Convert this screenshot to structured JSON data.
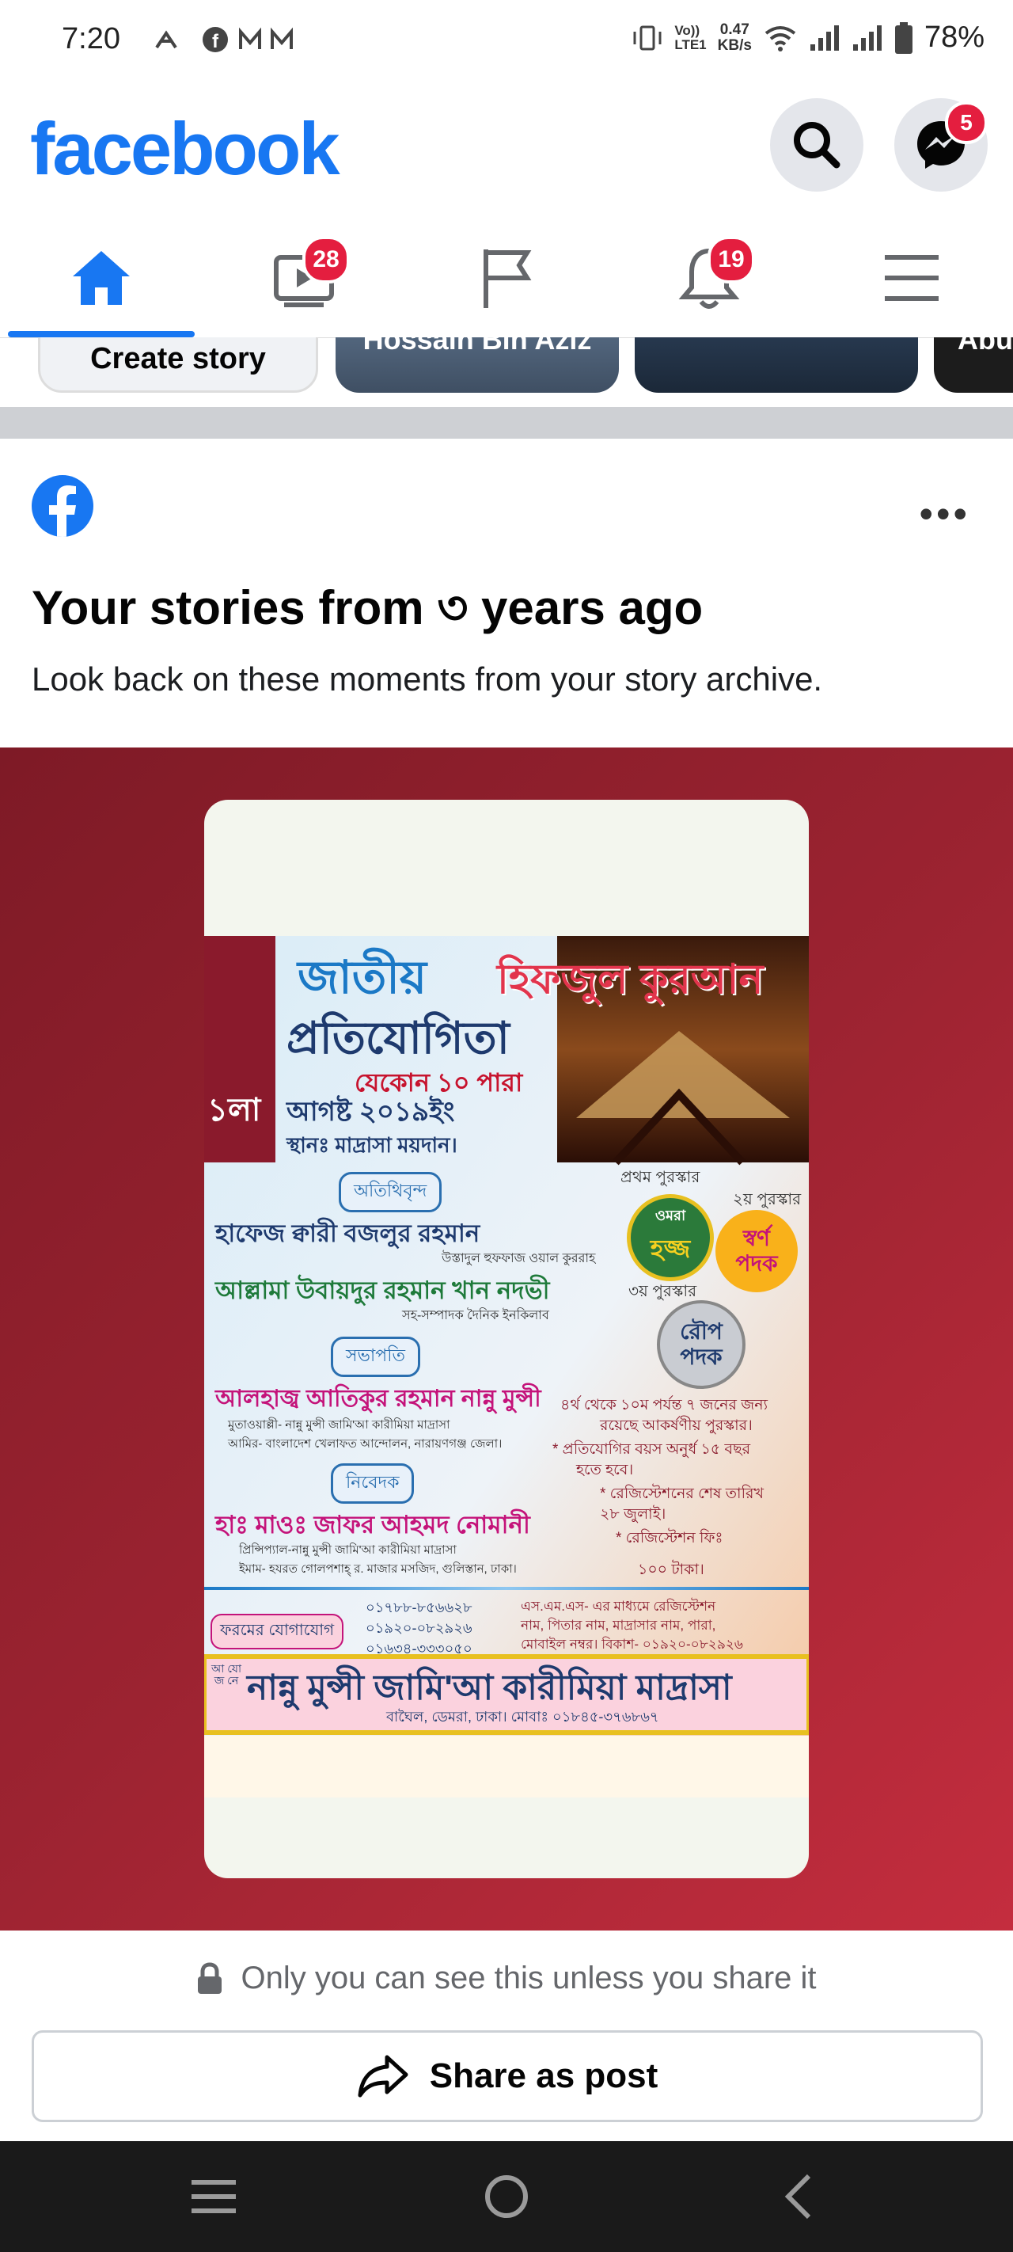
{
  "status_bar": {
    "time": "7:20",
    "net_line1": "Vo))",
    "net_line2": "LTE1",
    "speed_top": "0.47",
    "speed_bottom": "KB/s",
    "battery": "78%"
  },
  "header": {
    "logo": "facebook",
    "messenger_badge": "5"
  },
  "nav": {
    "video_badge": "28",
    "notif_badge": "19"
  },
  "stories": {
    "create_label": "Create story",
    "friend1": "Hossain Bin Aziz",
    "friend2": "Abu"
  },
  "memory_card": {
    "title": "Your stories from ৩ years ago",
    "subtitle": "Look back on these moments from your story archive."
  },
  "poster": {
    "title_word1": "জাতীয়",
    "title_word2": "হিফজুল কুরআন",
    "title_word3": "প্রতিযোগিতা",
    "para": "যেকোন ১০ পারা",
    "date_day": "১লা",
    "date": "আগষ্ট ২০১৯ইং",
    "venue": "স্থানঃ মাদ্রাসা ময়দান।",
    "guests_label": "অতিথিবৃন্দ",
    "guest1": "হাফেজ ক্বারী বজলুর রহমান",
    "guest1_role": "উস্তাদুল হুফফাজ ওয়াল কুররাহ",
    "guest2": "আল্লামা উবায়দুর রহমান খান নদভী",
    "guest2_role": "সহ-সম্পাদক দৈনিক ইনকিলাব",
    "chair_label": "সভাপতি",
    "chair": "আলহাজ্ব আতিকুর রহমান নান্নু মুন্সী",
    "chair_role1": "মুতাওয়াল্লী- নান্নু মুন্সী জামি'আ কারীমিয়া মাদ্রাসা",
    "chair_role2": "আমির- বাংলাদেশ খেলাফত আন্দোলন, নারায়ণগঞ্জ জেলা।",
    "organizer_label": "নিবেদক",
    "organizer": "হাঃ মাওঃ জাফর আহমদ নোমানী",
    "org_role1": "প্রিন্সিপ্যাল-নান্নু মুন্সী জামি'আ কারীমিয়া মাদ্রাসা",
    "org_role2": "ইমাম- হযরত গোলপশাহ্ র. মাজার মসজিদ, গুলিস্তান, ঢাকা।",
    "prize1_label": "প্রথম পুরস্কার",
    "prize1_a": "ওমরা",
    "prize1_b": "হজ্জ",
    "prize2_label": "২য় পুরস্কার",
    "prize2_a": "স্বর্ণ",
    "prize2_b": "পদক",
    "prize3_label": "৩য় পুরস্কার",
    "prize3_a": "রৌপ",
    "prize3_b": "পদক",
    "rule1": "৪র্থ থেকে ১০ম পর্যন্ত ৭ জনের জন্য",
    "rule1b": "রয়েছে আকর্ষণীয় পুরস্কার।",
    "rule2": "* প্রতিযোগির বয়স অনুর্ধ ১৫ বছর",
    "rule2b": "হতে হবে।",
    "rule3": "* রেজিস্টেশনের শেষ তারিখ",
    "rule3b": "২৮ জুলাই।",
    "rule4": "* রেজিস্টেশন ফিঃ",
    "rule4b": "১০০ টাকা।",
    "contact_label": "ফরমের যোগাযোগ",
    "phone1": "০১৭৮৮-৮৫৬৬২৮",
    "phone2": "০১৯২০-০৮২৯২৬",
    "phone3": "০১৬৩৪-৩৩৩০৫০",
    "sms1": "এস.এম.এস- এর মাধ্যমে রেজিস্টেশন",
    "sms2": "নাম, পিতার নাম, মাদ্রাসার নাম, পারা,",
    "sms3": "মোবাইল নম্বর। বিকাশ- ০১৯২০-০৮২৯২৬",
    "host_tag": "আ যো জ নে",
    "host": "নান্নু মুন্সী জামি'আ কারীমিয়া মাদ্রাসা",
    "host_addr": "বাঘৈল, ডেমরা, ঢাকা। মোবাঃ ০১৮৪৫-৩৭৬৮৬৭"
  },
  "footer": {
    "privacy": "Only you can see this unless you share it",
    "share": "Share as post"
  },
  "colors": {
    "brand": "#1877f2",
    "badge": "#e41e3f",
    "banner": "#9c2331"
  }
}
